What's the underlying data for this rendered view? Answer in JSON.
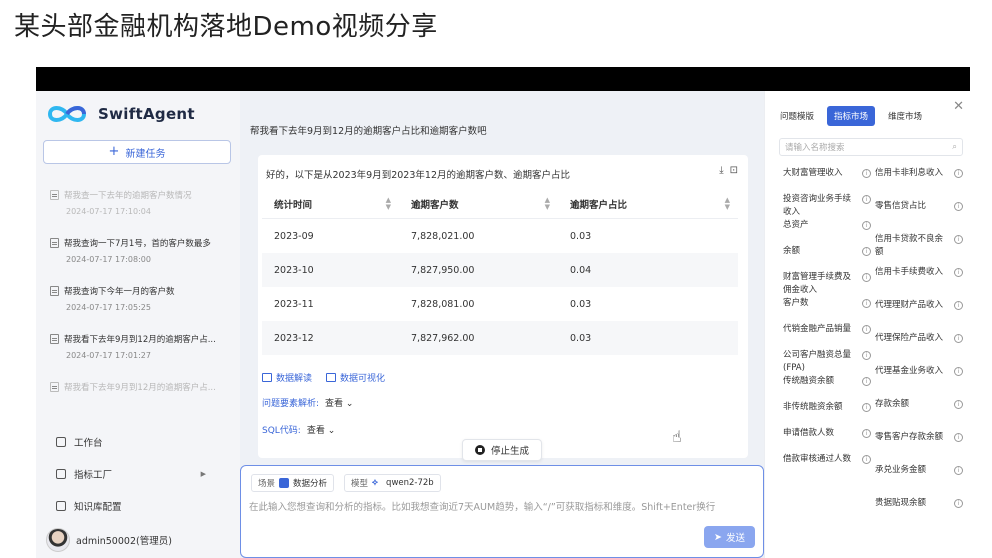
{
  "video_title": "某头部金融机构落地Demo视频分享",
  "app": {
    "logo_text": "SwiftAgent",
    "new_task_label": "新建任务"
  },
  "history": [
    {
      "title": "帮我查一下去年的逾期客户数情况",
      "time": "2024-07-17 17:10:04",
      "faded": true
    },
    {
      "title": "帮我查询一下7月1号，首的客户数最多",
      "time": "2024-07-17 17:08:00",
      "faded": false
    },
    {
      "title": "帮我查询下今年一月的客户数",
      "time": "2024-07-17 17:05:25",
      "faded": false
    },
    {
      "title": "帮我看下去年9月到12月的逾期客户占...",
      "time": "2024-07-17 17:01:27",
      "faded": false
    },
    {
      "title": "帮我看下去年9月到12月的逾期客户占...",
      "time": "",
      "faded": true
    }
  ],
  "nav": {
    "workbench": "工作台",
    "metrics_factory": "指标工厂",
    "kb_config": "知识库配置"
  },
  "user": {
    "name": "admin50002(管理员)"
  },
  "main": {
    "question": "帮我看下去年9月到12月的逾期客户占比和逾期客户数吧",
    "answer": "好的，以下是从2023年9月到2023年12月的逾期客户数、逾期客户占比",
    "table": {
      "headers": [
        "统计时间",
        "逾期客户数",
        "逾期客户占比"
      ],
      "rows": [
        [
          "2023-09",
          "7,828,021.00",
          "0.03"
        ],
        [
          "2023-10",
          "7,827,950.00",
          "0.04"
        ],
        [
          "2023-11",
          "7,828,081.00",
          "0.03"
        ],
        [
          "2023-12",
          "7,827,962.00",
          "0.03"
        ]
      ]
    },
    "action_interpret": "数据解读",
    "action_visualize": "数据可视化",
    "param_label": "问题要素解析:",
    "param_value": "查看",
    "sql_label": "SQL代码:",
    "sql_value": "查看",
    "stop_label": "停止生成",
    "scene_label": "场景",
    "scene_value": "数据分析",
    "model_label": "模型",
    "model_value": "qwen2-72b",
    "placeholder": "在此输入您想查询和分析的指标。比如我想查询近7天AUM趋势，输入“/”可获取指标和维度。Shift+Enter换行",
    "send_label": "发送"
  },
  "right_panel": {
    "tabs": [
      "问题模版",
      "指标市场",
      "维度市场"
    ],
    "active_tab": 1,
    "search_placeholder": "请输入名称搜索",
    "col1": [
      "大财富管理收入",
      "投资咨询业务手续收入",
      "总资产",
      "余额",
      "财富管理手续费及佣金收入",
      "客户数",
      "代销金融产品销量",
      "公司客户融资总量(FPA)",
      "传统融资余额",
      "非传统融资余额",
      "申请借款人数",
      "借款审核通过人数"
    ],
    "col2": [
      "信用卡非利息收入",
      "零售信贷占比",
      "信用卡贷款不良余额",
      "信用卡手续费收入",
      "代理理财产品收入",
      "代理保险产品收入",
      "代理基金业务收入",
      "存款余额",
      "零售客户存款余额",
      "承兑业务金额",
      "贵据贴现余额"
    ]
  },
  "colors": {
    "accent": "#3a66d8",
    "send_disabled": "#8aa6ef"
  }
}
